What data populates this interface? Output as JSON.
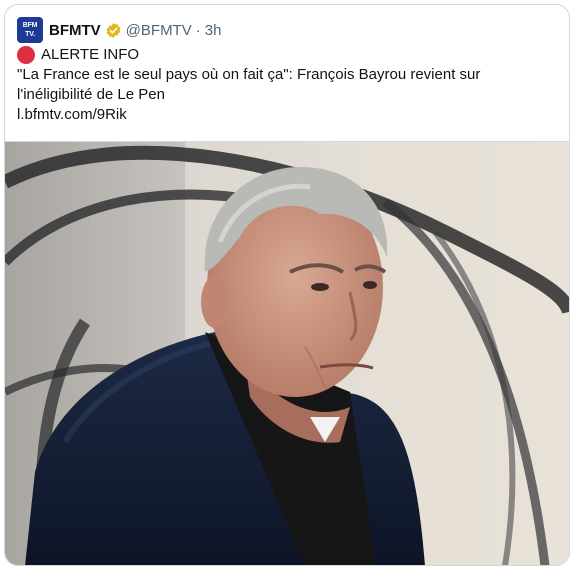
{
  "tweet": {
    "display_name": "BFMTV",
    "logo_text_line1": "BFM",
    "logo_text_line2": "TV.",
    "handle": "@BFMTV",
    "separator": "·",
    "time": "3h",
    "alert_label": "ALERTE INFO",
    "body_line1": "\"La France est le seul pays où on fait ça\": François Bayrou revient sur",
    "body_line2": "l'inéligibilité de Le Pen",
    "link": "l.bfmtv.com/9Rik"
  },
  "colors": {
    "brand_blue": "#1f3a93",
    "verified_gold": "#e2b719",
    "alert_red": "#dd2e44",
    "text_secondary": "#536471"
  },
  "icons": {
    "verified": "verified-badge-icon",
    "alert": "red-circle-icon"
  }
}
